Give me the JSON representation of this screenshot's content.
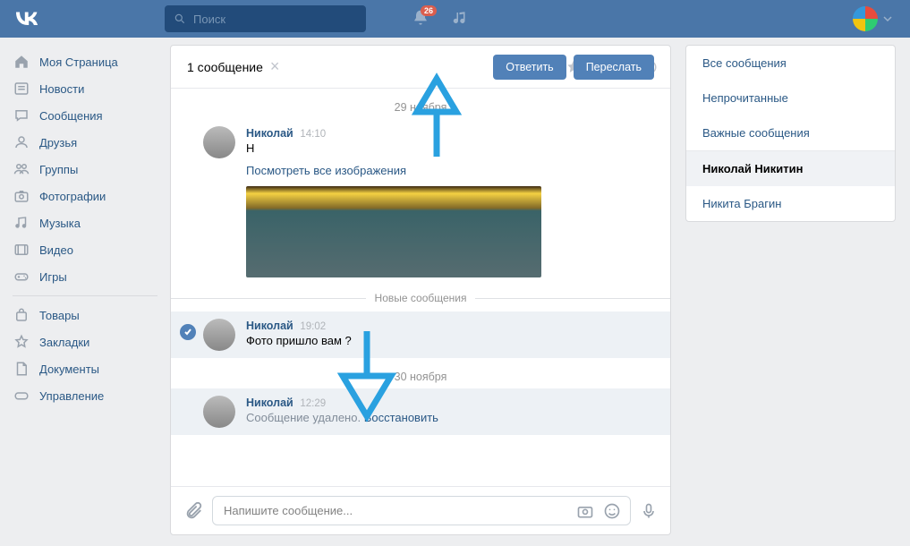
{
  "header": {
    "search_placeholder": "Поиск",
    "notification_count": "26"
  },
  "sidebar_left": {
    "items": [
      {
        "label": "Моя Страница",
        "icon": "home"
      },
      {
        "label": "Новости",
        "icon": "news"
      },
      {
        "label": "Сообщения",
        "icon": "messages"
      },
      {
        "label": "Друзья",
        "icon": "friends"
      },
      {
        "label": "Группы",
        "icon": "groups"
      },
      {
        "label": "Фотографии",
        "icon": "photos"
      },
      {
        "label": "Музыка",
        "icon": "music"
      },
      {
        "label": "Видео",
        "icon": "video"
      },
      {
        "label": "Игры",
        "icon": "games"
      }
    ],
    "items2": [
      {
        "label": "Товары",
        "icon": "market"
      },
      {
        "label": "Закладки",
        "icon": "bookmarks"
      },
      {
        "label": "Документы",
        "icon": "docs"
      },
      {
        "label": "Управление",
        "icon": "manage"
      }
    ]
  },
  "conversation": {
    "selection_text": "1 сообщение",
    "reply_button": "Ответить",
    "forward_button": "Переслать",
    "dates": {
      "d1": "29 ноября",
      "d2": "30 ноября"
    },
    "new_messages_label": "Новые сообщения",
    "messages": [
      {
        "author": "Николай",
        "time": "14:10",
        "text": "Н",
        "view_images": "Посмотреть все изображения"
      },
      {
        "author": "Николай",
        "time": "19:02",
        "text": "Фото пришло вам ?"
      },
      {
        "author": "Николай",
        "time": "12:29",
        "deleted_text": "Сообщение удалено.",
        "restore": "Восстановить"
      }
    ],
    "composer_placeholder": "Напишите сообщение..."
  },
  "sidebar_right": {
    "filters": [
      "Все сообщения",
      "Непрочитанные",
      "Важные сообщения"
    ],
    "dialogs": [
      {
        "name": "Николай Никитин",
        "active": true
      },
      {
        "name": "Никита Брагин",
        "active": false
      }
    ]
  },
  "annotation": {
    "arrow_color": "#2aa1e0"
  }
}
